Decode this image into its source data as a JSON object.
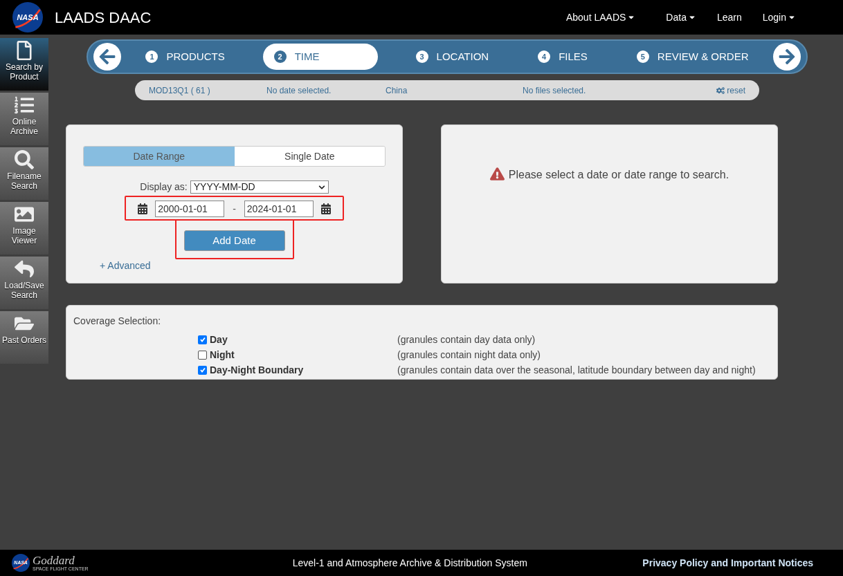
{
  "header": {
    "logo_text": "NASA",
    "title": "LAADS DAAC",
    "menu": [
      {
        "label": "About LAADS",
        "dropdown": true
      },
      {
        "label": "Data",
        "dropdown": true
      },
      {
        "label": "Learn",
        "dropdown": false
      },
      {
        "label": "Login",
        "dropdown": true
      }
    ]
  },
  "sidebar": {
    "items": [
      {
        "label": "Search by Product",
        "selected": true
      },
      {
        "label": "Online Archive",
        "selected": false
      },
      {
        "label": "Filename Search",
        "selected": false
      },
      {
        "label": "Image Viewer",
        "selected": false
      },
      {
        "label": "Load/Save Search",
        "selected": false
      },
      {
        "label": "Past Orders",
        "selected": false
      }
    ]
  },
  "stepper": {
    "steps": [
      {
        "number": "1",
        "label": "PRODUCTS",
        "selected": false
      },
      {
        "number": "2",
        "label": "TIME",
        "selected": true
      },
      {
        "number": "3",
        "label": "LOCATION",
        "selected": false
      },
      {
        "number": "4",
        "label": "FILES",
        "selected": false
      },
      {
        "number": "5",
        "label": "REVIEW & ORDER",
        "selected": false
      }
    ]
  },
  "summary": {
    "product": "MOD13Q1 ( 61 )",
    "date": "No date selected.",
    "location": "China",
    "files": "No files selected.",
    "reset": "reset"
  },
  "date_panel": {
    "tabs": [
      {
        "label": "Date Range",
        "selected": true
      },
      {
        "label": "Single Date",
        "selected": false
      }
    ],
    "display_label": "Display as:",
    "display_value": "YYYY-MM-DD",
    "start_date": "2000-01-01",
    "separator": "-",
    "end_date": "2024-01-01",
    "dates_highlighted": true,
    "add_button": "Add Date",
    "add_highlighted": true,
    "advanced_link": "+ Advanced"
  },
  "message": {
    "text": "Please select a date or date range to search."
  },
  "coverage": {
    "title": "Coverage Selection:",
    "options": [
      {
        "label": "Day",
        "checked": true,
        "description": "(granules contain day data only)"
      },
      {
        "label": "Night",
        "checked": false,
        "description": "(granules contain night data only)"
      },
      {
        "label": "Day-Night Boundary",
        "checked": true,
        "description": "(granules contain data over the seasonal, latitude boundary between day and night)"
      }
    ]
  },
  "footer": {
    "logo_text": "NASA",
    "goddard": "Goddard",
    "goddard_sub": "SPACE FLIGHT CENTER",
    "center": "Level-1 and Atmosphere Archive & Distribution System",
    "link": "Privacy Policy and Important Notices"
  }
}
